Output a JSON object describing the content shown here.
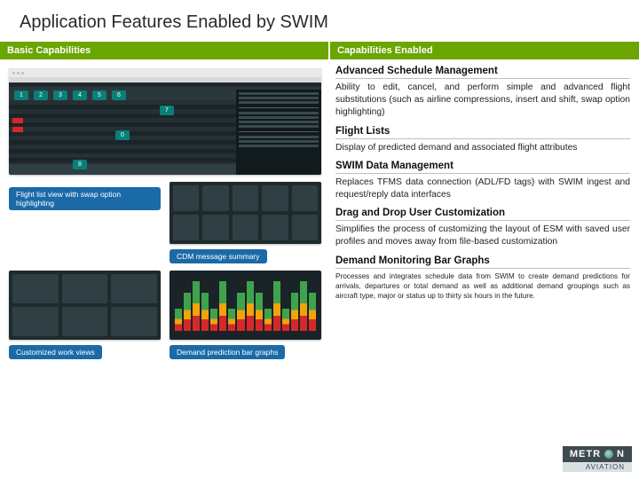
{
  "title": "Application Features Enabled by SWIM",
  "headers": {
    "left": "Basic Capabilities",
    "right": "Capabilities Enabled"
  },
  "captions": {
    "flight_list": "Flight list view with swap option highlighting",
    "cdm": "CDM message summary",
    "work_views": "Customized work views",
    "demand_bar": "Demand prediction bar graphs"
  },
  "badges": [
    "1",
    "2",
    "3",
    "4",
    "5",
    "6",
    "7",
    "0",
    "8"
  ],
  "capabilities": [
    {
      "heading": "Advanced Schedule Management",
      "body": "Ability to edit, cancel, and perform simple and advanced flight substitutions (such as airline compressions, insert and shift, swap option highlighting)"
    },
    {
      "heading": "Flight Lists",
      "body": "Display of predicted demand and associated flight attributes"
    },
    {
      "heading": "SWIM Data Management",
      "body": "Replaces TFMS data connection (ADL/FD tags) with SWIM ingest and request/reply data interfaces"
    },
    {
      "heading": "Drag and Drop User Customization",
      "body": "Simplifies the process of customizing the layout of ESM with saved user profiles and moves away from file-based customization"
    },
    {
      "heading": "Demand Monitoring Bar Graphs",
      "body": "Processes and integrates schedule data from SWIM to create demand predictions for arrivals, departures or total demand as well as additional demand groupings such as aircraft type, major or status up to thirty six hours in the future.",
      "small": true
    }
  ],
  "logo": {
    "brand": "METRON",
    "sub": "AVIATION"
  }
}
